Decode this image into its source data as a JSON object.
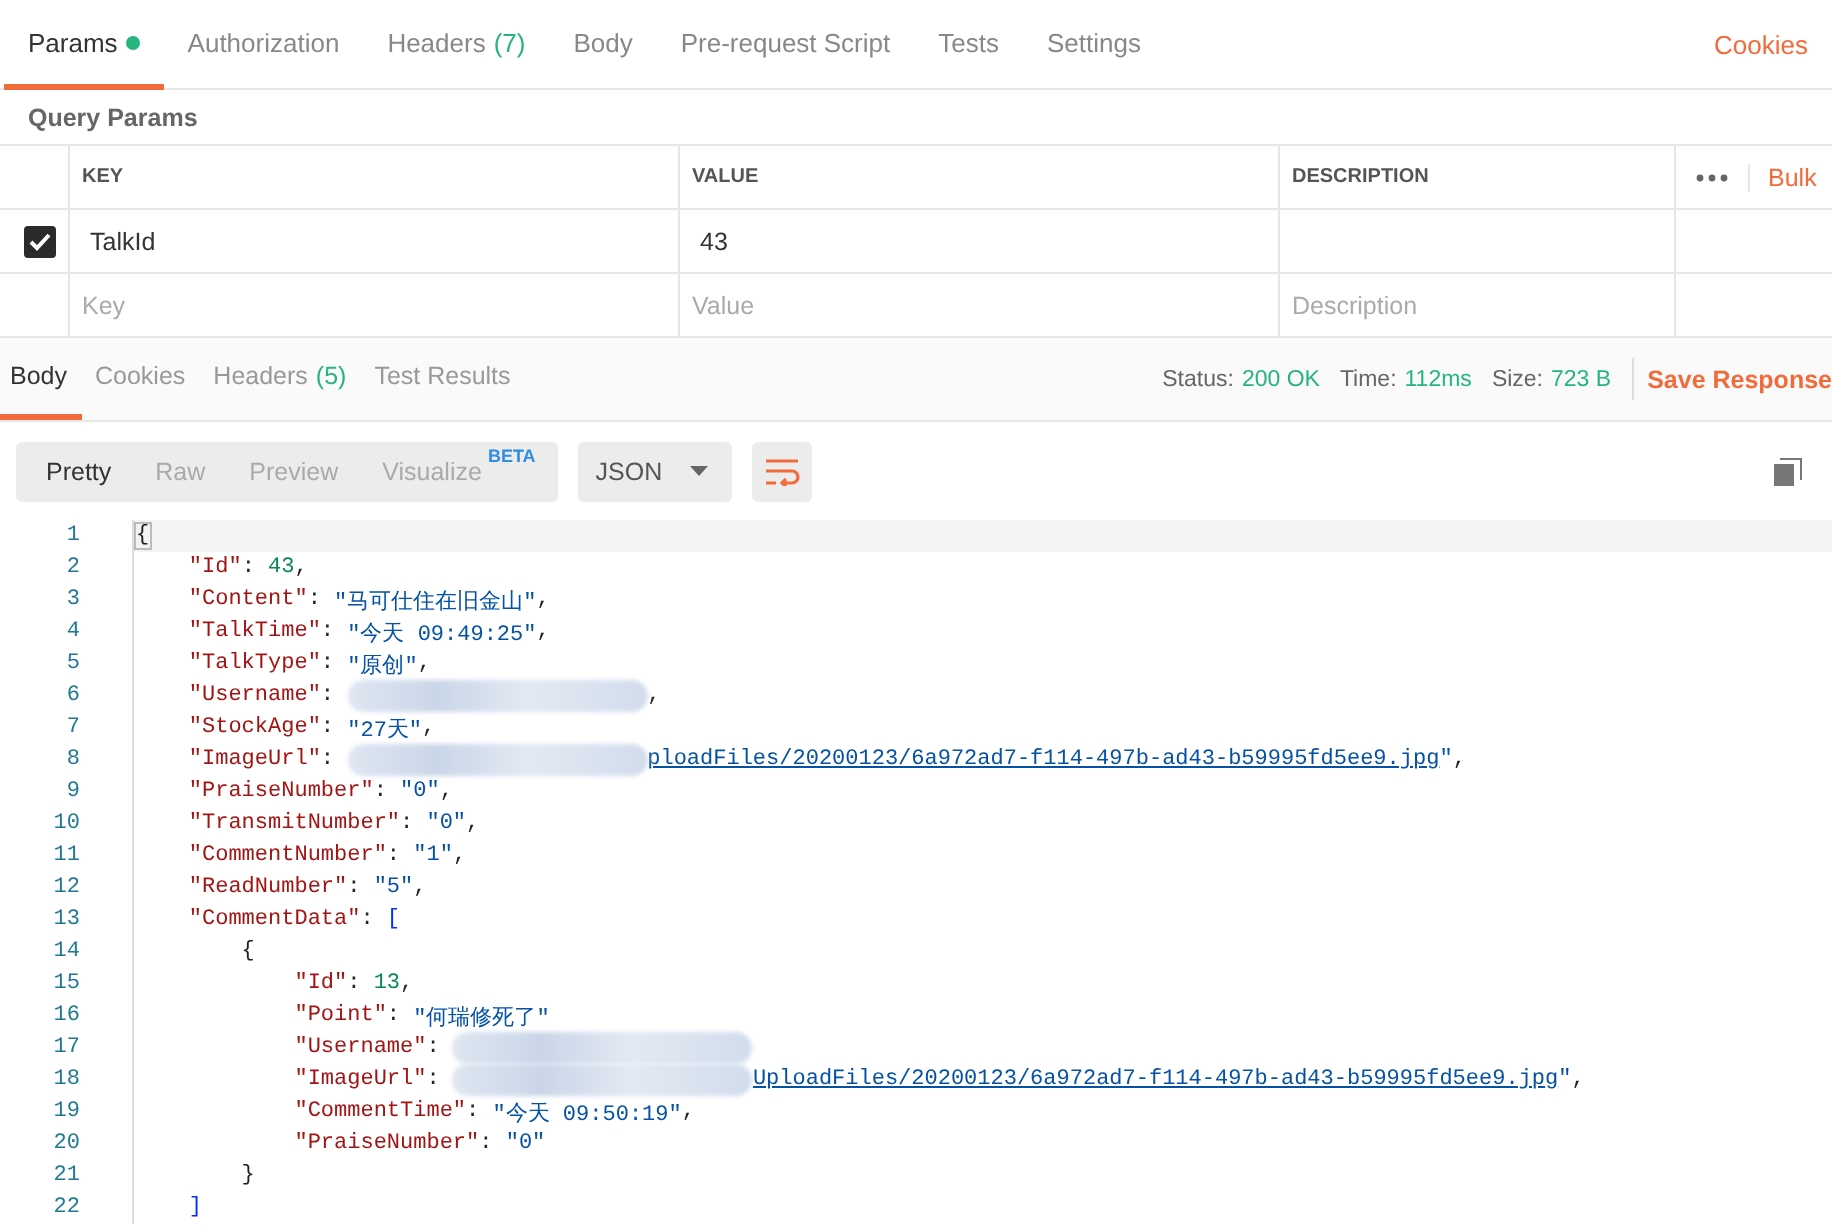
{
  "request_tabs": [
    {
      "label": "Params",
      "selected": true,
      "dot": true
    },
    {
      "label": "Authorization",
      "selected": false
    },
    {
      "label": "Headers",
      "count": "(7)",
      "selected": false
    },
    {
      "label": "Body",
      "selected": false
    },
    {
      "label": "Pre-request Script",
      "selected": false
    },
    {
      "label": "Tests",
      "selected": false
    },
    {
      "label": "Settings",
      "selected": false
    }
  ],
  "cookies_link": "Cookies",
  "query_params": {
    "title": "Query Params",
    "columns": [
      "KEY",
      "VALUE",
      "DESCRIPTION"
    ],
    "bulk_edit": "Bulk",
    "rows": [
      {
        "checked": true,
        "key": "TalkId",
        "value": "43"
      }
    ],
    "new_row": {
      "key": {
        "placeholder": "Key"
      },
      "value": {
        "placeholder": "Value"
      },
      "description": {
        "placeholder": "Description"
      }
    }
  },
  "response_tabs": [
    {
      "label": "Body",
      "selected": true
    },
    {
      "label": "Cookies",
      "selected": false
    },
    {
      "label": "Headers",
      "count": "(5)",
      "selected": false
    },
    {
      "label": "Test Results",
      "selected": false
    }
  ],
  "response_meta": [
    {
      "label": "Status:",
      "value": "200 OK"
    },
    {
      "label": "Time:",
      "value": "112ms"
    },
    {
      "label": "Size:",
      "value": "723 B"
    }
  ],
  "save_response": "Save Response",
  "view_modes": [
    {
      "label": "Pretty",
      "selected": true
    },
    {
      "label": "Raw",
      "selected": false
    },
    {
      "label": "Preview",
      "selected": false
    },
    {
      "label": "Visualize",
      "badge": "BETA",
      "selected": false
    }
  ],
  "format": "JSON",
  "wrap_lines": true,
  "code_lines": [
    {
      "number": "1",
      "current": true,
      "tokens": [
        {
          "kind": "punct",
          "text": "{"
        }
      ]
    },
    {
      "number": "2",
      "current": false,
      "tokens": [
        {
          "kind": "key",
          "text": "    \"Id\""
        },
        {
          "kind": "punct",
          "text": ": "
        },
        {
          "kind": "number",
          "text": "43"
        },
        {
          "kind": "punct",
          "text": ","
        }
      ]
    },
    {
      "number": "3",
      "current": false,
      "tokens": [
        {
          "kind": "key",
          "text": "    \"Content\""
        },
        {
          "kind": "punct",
          "text": ": "
        },
        {
          "kind": "string",
          "text": "\"马可仕住在旧金山\""
        },
        {
          "kind": "punct",
          "text": ","
        }
      ]
    },
    {
      "number": "4",
      "current": false,
      "tokens": [
        {
          "kind": "key",
          "text": "    \"TalkTime\""
        },
        {
          "kind": "punct",
          "text": ": "
        },
        {
          "kind": "string",
          "text": "\"今天 09:49:25\""
        },
        {
          "kind": "punct",
          "text": ","
        }
      ]
    },
    {
      "number": "5",
      "current": false,
      "tokens": [
        {
          "kind": "key",
          "text": "    \"TalkType\""
        },
        {
          "kind": "punct",
          "text": ": "
        },
        {
          "kind": "string",
          "text": "\"原创\""
        },
        {
          "kind": "punct",
          "text": ","
        }
      ]
    },
    {
      "number": "6",
      "current": false,
      "tokens": [
        {
          "kind": "key",
          "text": "    \"Username\""
        },
        {
          "kind": "punct",
          "text": ": "
        },
        {
          "kind": "redacted"
        },
        {
          "kind": "punct",
          "text": ","
        }
      ]
    },
    {
      "number": "7",
      "current": false,
      "tokens": [
        {
          "kind": "key",
          "text": "    \"StockAge\""
        },
        {
          "kind": "punct",
          "text": ": "
        },
        {
          "kind": "string",
          "text": "\"27天\""
        },
        {
          "kind": "punct",
          "text": ","
        }
      ]
    },
    {
      "number": "8",
      "current": false,
      "tokens": [
        {
          "kind": "key",
          "text": "    \"ImageUrl\""
        },
        {
          "kind": "punct",
          "text": ": "
        },
        {
          "kind": "redacted"
        },
        {
          "kind": "link",
          "text": "ploadFiles/20200123/6a972ad7-f114-497b-ad43-b59995fd5ee9.jpg"
        },
        {
          "kind": "string",
          "text": "\""
        },
        {
          "kind": "punct",
          "text": ","
        }
      ]
    },
    {
      "number": "9",
      "current": false,
      "tokens": [
        {
          "kind": "key",
          "text": "    \"PraiseNumber\""
        },
        {
          "kind": "punct",
          "text": ": "
        },
        {
          "kind": "string",
          "text": "\"0\""
        },
        {
          "kind": "punct",
          "text": ","
        }
      ]
    },
    {
      "number": "10",
      "current": false,
      "tokens": [
        {
          "kind": "key",
          "text": "    \"TransmitNumber\""
        },
        {
          "kind": "punct",
          "text": ": "
        },
        {
          "kind": "string",
          "text": "\"0\""
        },
        {
          "kind": "punct",
          "text": ","
        }
      ]
    },
    {
      "number": "11",
      "current": false,
      "tokens": [
        {
          "kind": "key",
          "text": "    \"CommentNumber\""
        },
        {
          "kind": "punct",
          "text": ": "
        },
        {
          "kind": "string",
          "text": "\"1\""
        },
        {
          "kind": "punct",
          "text": ","
        }
      ]
    },
    {
      "number": "12",
      "current": false,
      "tokens": [
        {
          "kind": "key",
          "text": "    \"ReadNumber\""
        },
        {
          "kind": "punct",
          "text": ": "
        },
        {
          "kind": "string",
          "text": "\"5\""
        },
        {
          "kind": "punct",
          "text": ","
        }
      ]
    },
    {
      "number": "13",
      "current": false,
      "tokens": [
        {
          "kind": "key",
          "text": "    \"CommentData\""
        },
        {
          "kind": "punct",
          "text": ": "
        },
        {
          "kind": "bracket",
          "text": "["
        }
      ]
    },
    {
      "number": "14",
      "current": false,
      "tokens": [
        {
          "kind": "punct",
          "text": "        {"
        }
      ]
    },
    {
      "number": "15",
      "current": false,
      "tokens": [
        {
          "kind": "key",
          "text": "            \"Id\""
        },
        {
          "kind": "punct",
          "text": ": "
        },
        {
          "kind": "number",
          "text": "13"
        },
        {
          "kind": "punct",
          "text": ","
        }
      ]
    },
    {
      "number": "16",
      "current": false,
      "tokens": [
        {
          "kind": "key",
          "text": "            \"Point\""
        },
        {
          "kind": "punct",
          "text": ": "
        },
        {
          "kind": "string",
          "text": "\"何瑞修死了\""
        }
      ]
    },
    {
      "number": "17",
      "current": false,
      "tokens": [
        {
          "kind": "key",
          "text": "            \"Username\""
        },
        {
          "kind": "punct",
          "text": ": "
        },
        {
          "kind": "redacted"
        }
      ]
    },
    {
      "number": "18",
      "current": false,
      "tokens": [
        {
          "kind": "key",
          "text": "            \"ImageUrl\""
        },
        {
          "kind": "punct",
          "text": ": "
        },
        {
          "kind": "redacted"
        },
        {
          "kind": "link",
          "text": "UploadFiles/20200123/6a972ad7-f114-497b-ad43-b59995fd5ee9.jpg"
        },
        {
          "kind": "string",
          "text": "\""
        },
        {
          "kind": "punct",
          "text": ","
        }
      ]
    },
    {
      "number": "19",
      "current": false,
      "tokens": [
        {
          "kind": "key",
          "text": "            \"CommentTime\""
        },
        {
          "kind": "punct",
          "text": ": "
        },
        {
          "kind": "string",
          "text": "\"今天 09:50:19\""
        },
        {
          "kind": "punct",
          "text": ","
        }
      ]
    },
    {
      "number": "20",
      "current": false,
      "tokens": [
        {
          "kind": "key",
          "text": "            \"PraiseNumber\""
        },
        {
          "kind": "punct",
          "text": ": "
        },
        {
          "kind": "string",
          "text": "\"0\""
        }
      ]
    },
    {
      "number": "21",
      "current": false,
      "tokens": [
        {
          "kind": "punct",
          "text": "        }"
        }
      ]
    },
    {
      "number": "22",
      "current": false,
      "tokens": [
        {
          "kind": "bracket",
          "text": "    ]"
        }
      ]
    }
  ]
}
